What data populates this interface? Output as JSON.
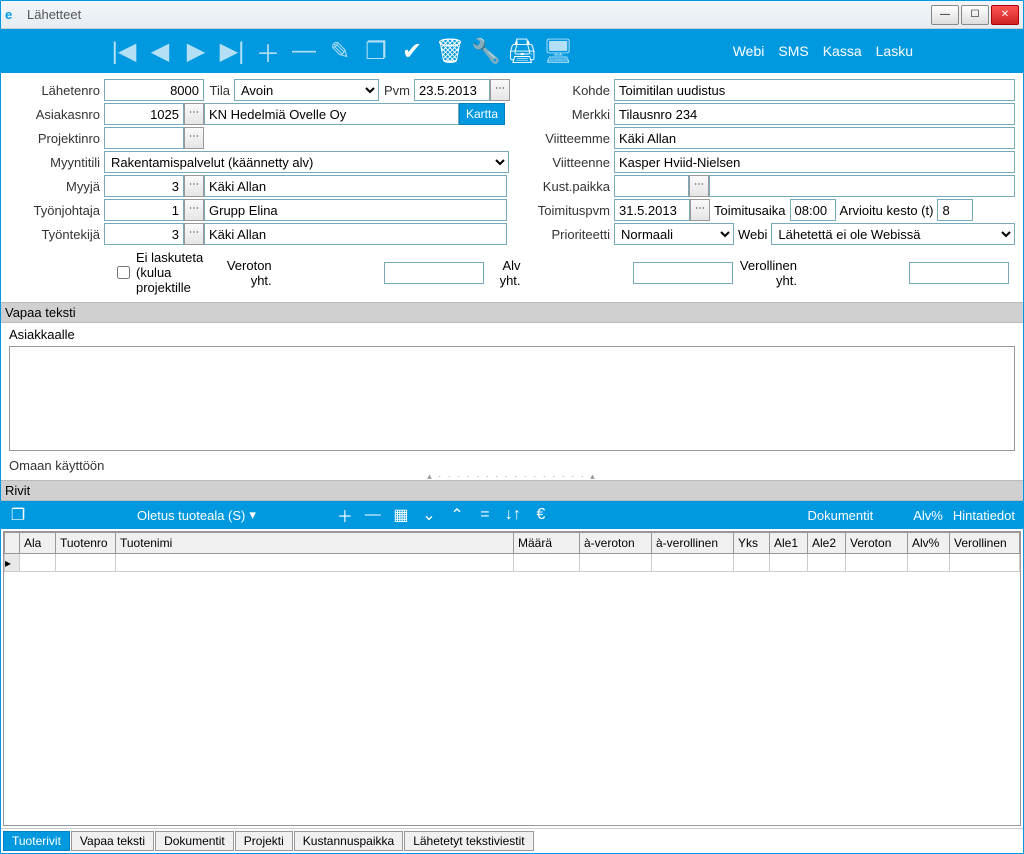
{
  "window": {
    "title": "Lähetteet"
  },
  "toolbar": {
    "webi": "Webi",
    "sms": "SMS",
    "kassa": "Kassa",
    "lasku": "Lasku"
  },
  "form": {
    "lahetenro_label": "Lähetenro",
    "lahetenro": "8000",
    "tila_label": "Tila",
    "tila": "Avoin",
    "pvm_label": "Pvm",
    "pvm": "23.5.2013",
    "kohde_label": "Kohde",
    "kohde": "Toimitilan uudistus",
    "asiakasnro_label": "Asiakasnro",
    "asiakasnro": "1025",
    "asiakas_name": "KN Hedelmiä Ovelle Oy",
    "kartta": "Kartta",
    "merkki_label": "Merkki",
    "merkki": "Tilausnro 234",
    "projektinro_label": "Projektinro",
    "projektinro": "",
    "viitteemme_label": "Viitteemme",
    "viitteemme": "Käki Allan",
    "myyntitili_label": "Myyntitili",
    "myyntitili": "Rakentamispalvelut (käännetty alv)",
    "viitteenne_label": "Viitteenne",
    "viitteenne": "Kasper Hviid-Nielsen",
    "myyja_label": "Myyjä",
    "myyja_nro": "3",
    "myyja_name": "Käki Allan",
    "kustpaikka_label": "Kust.paikka",
    "kustpaikka": "",
    "tyonjohtaja_label": "Työnjohtaja",
    "tyonjohtaja_nro": "1",
    "tyonjohtaja_name": "Grupp Elina",
    "toimituspvm_label": "Toimituspvm",
    "toimituspvm": "31.5.2013",
    "toimitusaika_label": "Toimitusaika",
    "toimitusaika": "08:00",
    "arvioitu_label": "Arvioitu kesto (t)",
    "arvioitu": "8",
    "tyontekija_label": "Työntekijä",
    "tyontekija_nro": "3",
    "tyontekija_name": "Käki Allan",
    "prioriteetti_label": "Prioriteetti",
    "prioriteetti": "Normaali",
    "webi_label": "Webi",
    "webi_status": "Lähetettä ei ole Webissä",
    "ei_laskuteta": "Ei laskuteta (kulua projektille",
    "veroton_label": "Veroton yht.",
    "alv_label": "Alv yht.",
    "verollinen_label": "Verollinen yht."
  },
  "sections": {
    "vapaa_teksti": "Vapaa teksti",
    "asiakkaalle": "Asiakkaalle",
    "omaan": "Omaan käyttöön",
    "rivit": "Rivit"
  },
  "rows_toolbar": {
    "oletus": "Oletus tuoteala (S)",
    "dokumentit": "Dokumentit",
    "alv": "Alv%",
    "hintatiedot": "Hintatiedot"
  },
  "columns": {
    "ala": "Ala",
    "tuotenro": "Tuotenro",
    "tuotenimi": "Tuotenimi",
    "maara": "Määrä",
    "a_veroton": "à-veroton",
    "a_verollinen": "à-verollinen",
    "yks": "Yks",
    "ale1": "Ale1",
    "ale2": "Ale2",
    "veroton": "Veroton",
    "alv": "Alv%",
    "verollinen": "Verollinen"
  },
  "tabs": {
    "tuoterivit": "Tuoterivit",
    "vapaa_teksti": "Vapaa teksti",
    "dokumentit": "Dokumentit",
    "projekti": "Projekti",
    "kustannuspaikka": "Kustannuspaikka",
    "lahetetyt": "Lähetetyt tekstiviestit"
  }
}
